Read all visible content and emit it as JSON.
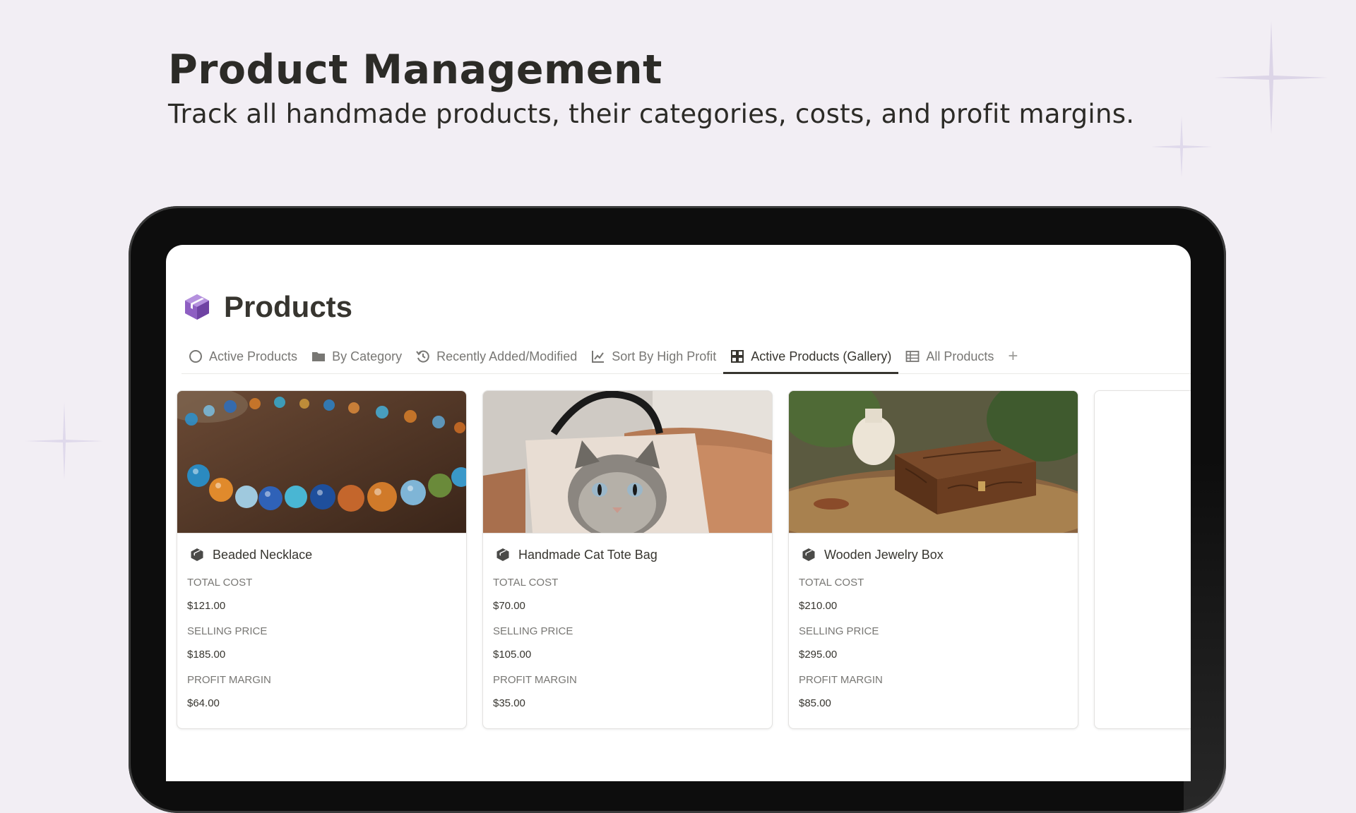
{
  "hero": {
    "title": "Product Management",
    "subtitle": "Track all handmade products, their categories, costs, and profit margins."
  },
  "page": {
    "title": "Products",
    "icon": "purple-box-icon"
  },
  "tabs": [
    {
      "label": "Active Products",
      "icon": "circle-icon"
    },
    {
      "label": "By Category",
      "icon": "folder-icon"
    },
    {
      "label": "Recently Added/Modified",
      "icon": "history-icon"
    },
    {
      "label": "Sort By High Profit",
      "icon": "line-chart-icon"
    },
    {
      "label": "Active Products (Gallery)",
      "icon": "gallery-icon",
      "active": true
    },
    {
      "label": "All Products",
      "icon": "table-icon"
    }
  ],
  "add_view_icon": "plus-icon",
  "cards": [
    {
      "title": "Beaded Necklace",
      "image": "beaded-necklace-photo",
      "props": [
        {
          "label": "TOTAL COST",
          "value": "$121.00"
        },
        {
          "label": "SELLING PRICE",
          "value": "$185.00"
        },
        {
          "label": "PROFIT MARGIN",
          "value": "$64.00"
        }
      ]
    },
    {
      "title": "Handmade Cat Tote Bag",
      "image": "cat-tote-bag-photo",
      "props": [
        {
          "label": "TOTAL COST",
          "value": "$70.00"
        },
        {
          "label": "SELLING PRICE",
          "value": "$105.00"
        },
        {
          "label": "PROFIT MARGIN",
          "value": "$35.00"
        }
      ]
    },
    {
      "title": "Wooden Jewelry Box",
      "image": "wooden-jewelry-box-photo",
      "props": [
        {
          "label": "TOTAL COST",
          "value": "$210.00"
        },
        {
          "label": "SELLING PRICE",
          "value": "$295.00"
        },
        {
          "label": "PROFIT MARGIN",
          "value": "$85.00"
        }
      ]
    }
  ],
  "colors": {
    "background": "#f2eef4",
    "accent": "#8e5fc2",
    "device": "#0d0d0d",
    "text": "#37352f",
    "muted": "#787774"
  }
}
